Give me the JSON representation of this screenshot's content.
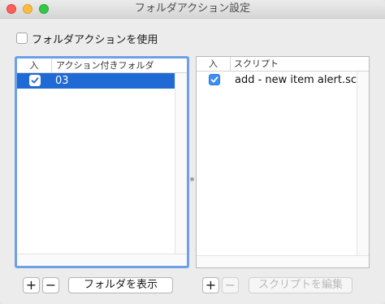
{
  "window": {
    "title": "フォルダアクション設定"
  },
  "enable": {
    "label": "フォルダアクションを使用",
    "checked": false
  },
  "folders_table": {
    "col_enabled": "入",
    "col_name": "アクション付きフォルダ",
    "rows": [
      {
        "enabled": true,
        "name": "03",
        "selected": true
      }
    ]
  },
  "scripts_table": {
    "col_enabled": "入",
    "col_name": "スクリプト",
    "rows": [
      {
        "enabled": true,
        "name": "add - new item alert.scpt",
        "selected": false
      }
    ]
  },
  "folder_buttons": {
    "add": "+",
    "remove": "−",
    "show": "フォルダを表示"
  },
  "script_buttons": {
    "add": "+",
    "remove": "−",
    "edit": "スクリプトを編集"
  },
  "colors": {
    "selection": "#1f6ad4",
    "focus_ring": "#6ea0e8",
    "checkbox_on": "#3d8ef4"
  }
}
